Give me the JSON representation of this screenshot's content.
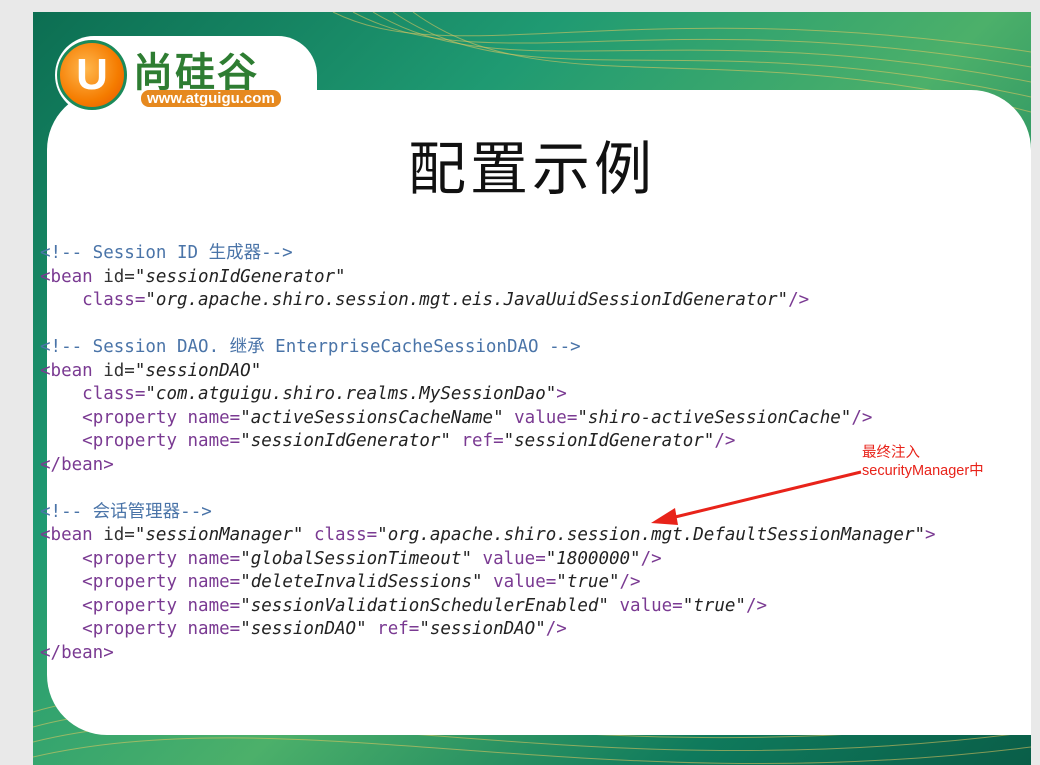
{
  "logo": {
    "letter": "U",
    "name": "尚硅谷",
    "url": "www.atguigu.com"
  },
  "title": "配置示例",
  "code_lines": [
    [
      {
        "c": "c",
        "t": "<!-- Session ID 生成器-->"
      }
    ],
    [
      {
        "c": "t",
        "t": "<bean "
      },
      {
        "c": "p",
        "t": "id="
      },
      {
        "c": "s",
        "t": "\"sessionIdGenerator\""
      }
    ],
    [
      {
        "c": "p",
        "t": "    "
      },
      {
        "c": "t",
        "t": "class="
      },
      {
        "c": "s",
        "t": "\"org.apache.shiro.session.mgt.eis.JavaUuidSessionIdGenerator\""
      },
      {
        "c": "t",
        "t": "/>"
      }
    ],
    [],
    [
      {
        "c": "c",
        "t": "<!-- Session DAO. 继承 EnterpriseCacheSessionDAO -->"
      }
    ],
    [
      {
        "c": "t",
        "t": "<bean "
      },
      {
        "c": "p",
        "t": "id="
      },
      {
        "c": "s",
        "t": "\"sessionDAO\""
      }
    ],
    [
      {
        "c": "p",
        "t": "    "
      },
      {
        "c": "t",
        "t": "class="
      },
      {
        "c": "s",
        "t": "\"com.atguigu.shiro.realms.MySessionDao\""
      },
      {
        "c": "t",
        "t": ">"
      }
    ],
    [
      {
        "c": "p",
        "t": "    "
      },
      {
        "c": "t",
        "t": "<property "
      },
      {
        "c": "t",
        "t": "name="
      },
      {
        "c": "s",
        "t": "\"activeSessionsCacheName\""
      },
      {
        "c": "t",
        "t": " value="
      },
      {
        "c": "s",
        "t": "\"shiro-activeSessionCache\""
      },
      {
        "c": "t",
        "t": "/>"
      }
    ],
    [
      {
        "c": "p",
        "t": "    "
      },
      {
        "c": "t",
        "t": "<property "
      },
      {
        "c": "t",
        "t": "name="
      },
      {
        "c": "s",
        "t": "\"sessionIdGenerator\""
      },
      {
        "c": "t",
        "t": " ref="
      },
      {
        "c": "s",
        "t": "\"sessionIdGenerator\""
      },
      {
        "c": "t",
        "t": "/>"
      }
    ],
    [
      {
        "c": "t",
        "t": "</bean>"
      }
    ],
    [],
    [
      {
        "c": "c",
        "t": "<!-- 会话管理器-->"
      }
    ],
    [
      {
        "c": "t",
        "t": "<bean "
      },
      {
        "c": "p",
        "t": "id="
      },
      {
        "c": "s",
        "t": "\"sessionManager\""
      },
      {
        "c": "t",
        "t": " class="
      },
      {
        "c": "s",
        "t": "\"org.apache.shiro.session.mgt.DefaultSessionManager\""
      },
      {
        "c": "t",
        "t": ">"
      }
    ],
    [
      {
        "c": "p",
        "t": "    "
      },
      {
        "c": "t",
        "t": "<property "
      },
      {
        "c": "t",
        "t": "name="
      },
      {
        "c": "s",
        "t": "\"globalSessionTimeout\""
      },
      {
        "c": "t",
        "t": " value="
      },
      {
        "c": "s",
        "t": "\"1800000\""
      },
      {
        "c": "t",
        "t": "/>"
      }
    ],
    [
      {
        "c": "p",
        "t": "    "
      },
      {
        "c": "t",
        "t": "<property "
      },
      {
        "c": "t",
        "t": "name="
      },
      {
        "c": "s",
        "t": "\"deleteInvalidSessions\""
      },
      {
        "c": "t",
        "t": " value="
      },
      {
        "c": "s",
        "t": "\"true\""
      },
      {
        "c": "t",
        "t": "/>"
      }
    ],
    [
      {
        "c": "p",
        "t": "    "
      },
      {
        "c": "t",
        "t": "<property "
      },
      {
        "c": "t",
        "t": "name="
      },
      {
        "c": "s",
        "t": "\"sessionValidationSchedulerEnabled\""
      },
      {
        "c": "t",
        "t": " value="
      },
      {
        "c": "s",
        "t": "\"true\""
      },
      {
        "c": "t",
        "t": "/>"
      }
    ],
    [
      {
        "c": "p",
        "t": "    "
      },
      {
        "c": "t",
        "t": "<property "
      },
      {
        "c": "t",
        "t": "name="
      },
      {
        "c": "s",
        "t": "\"sessionDAO\""
      },
      {
        "c": "t",
        "t": " ref="
      },
      {
        "c": "s",
        "t": "\"sessionDAO\""
      },
      {
        "c": "t",
        "t": "/>"
      }
    ],
    [
      {
        "c": "t",
        "t": "</bean>"
      }
    ]
  ],
  "annotation": {
    "line1": "最终注入",
    "line2": "securityManager中",
    "color": "#e8231a"
  },
  "colors": {
    "comment": "#4a74a8",
    "tag": "#7a3a92",
    "string": "#222222",
    "accent_green": "#1f9a72"
  }
}
